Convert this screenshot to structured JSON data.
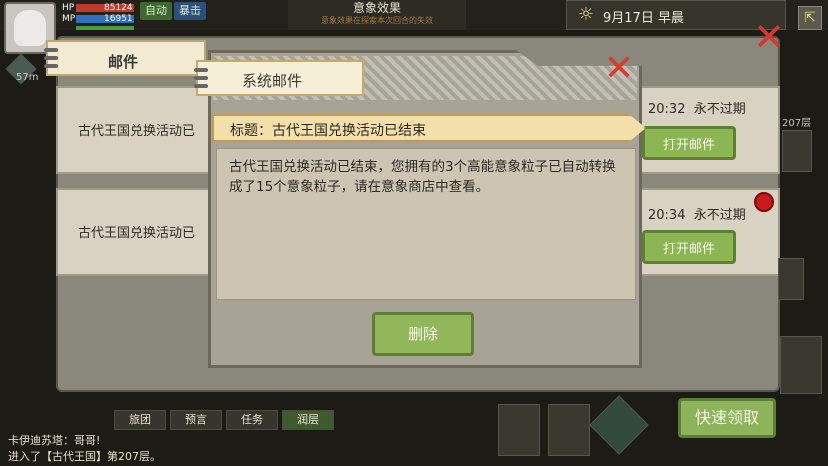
{
  "status": {
    "hp_label": "HP",
    "hp_value": "85124",
    "mp_label": "MP",
    "mp_value": "16951",
    "mode_button": "自动",
    "active_button": "暴击",
    "distance": "57m"
  },
  "effect_panel": {
    "title": "意象效果",
    "subtitle": "意象效果在探索本次回合的失效"
  },
  "date_panel": {
    "date_text": "9月17日 早晨"
  },
  "mail_panel": {
    "tab_label": "邮件",
    "rows": [
      {
        "subject": "古代王国兑换活动已",
        "time": "20:32",
        "expiry": "永不过期",
        "open_label": "打开邮件"
      },
      {
        "subject": "古代王国兑换活动已",
        "time": "20:34",
        "expiry": "永不过期",
        "open_label": "打开邮件"
      }
    ],
    "side_floor": "207层"
  },
  "dialog": {
    "tab_label": "系统邮件",
    "title": "标题：古代王国兑换活动已结束",
    "body": "古代王国兑换活动已结束，您拥有的3个高能意象粒子已自动转换成了15个意象粒子，请在意象商店中查看。",
    "delete_label": "删除"
  },
  "chat": {
    "buttons": [
      "旅团",
      "预言",
      "任务",
      "润层"
    ],
    "line1": "卡伊迪苏塔：哥哥!",
    "line2": "进入了【古代王国】第207层。"
  },
  "quick_claim_label": "快速领取",
  "colors": {
    "accent_green": "#8db45b",
    "close_red": "#d33a2c",
    "title_bar": "#f3dfaa",
    "dialog_bg": "#a7a397"
  },
  "icons": [
    "sun-icon",
    "close-icon",
    "exit-icon",
    "settings-icon"
  ]
}
